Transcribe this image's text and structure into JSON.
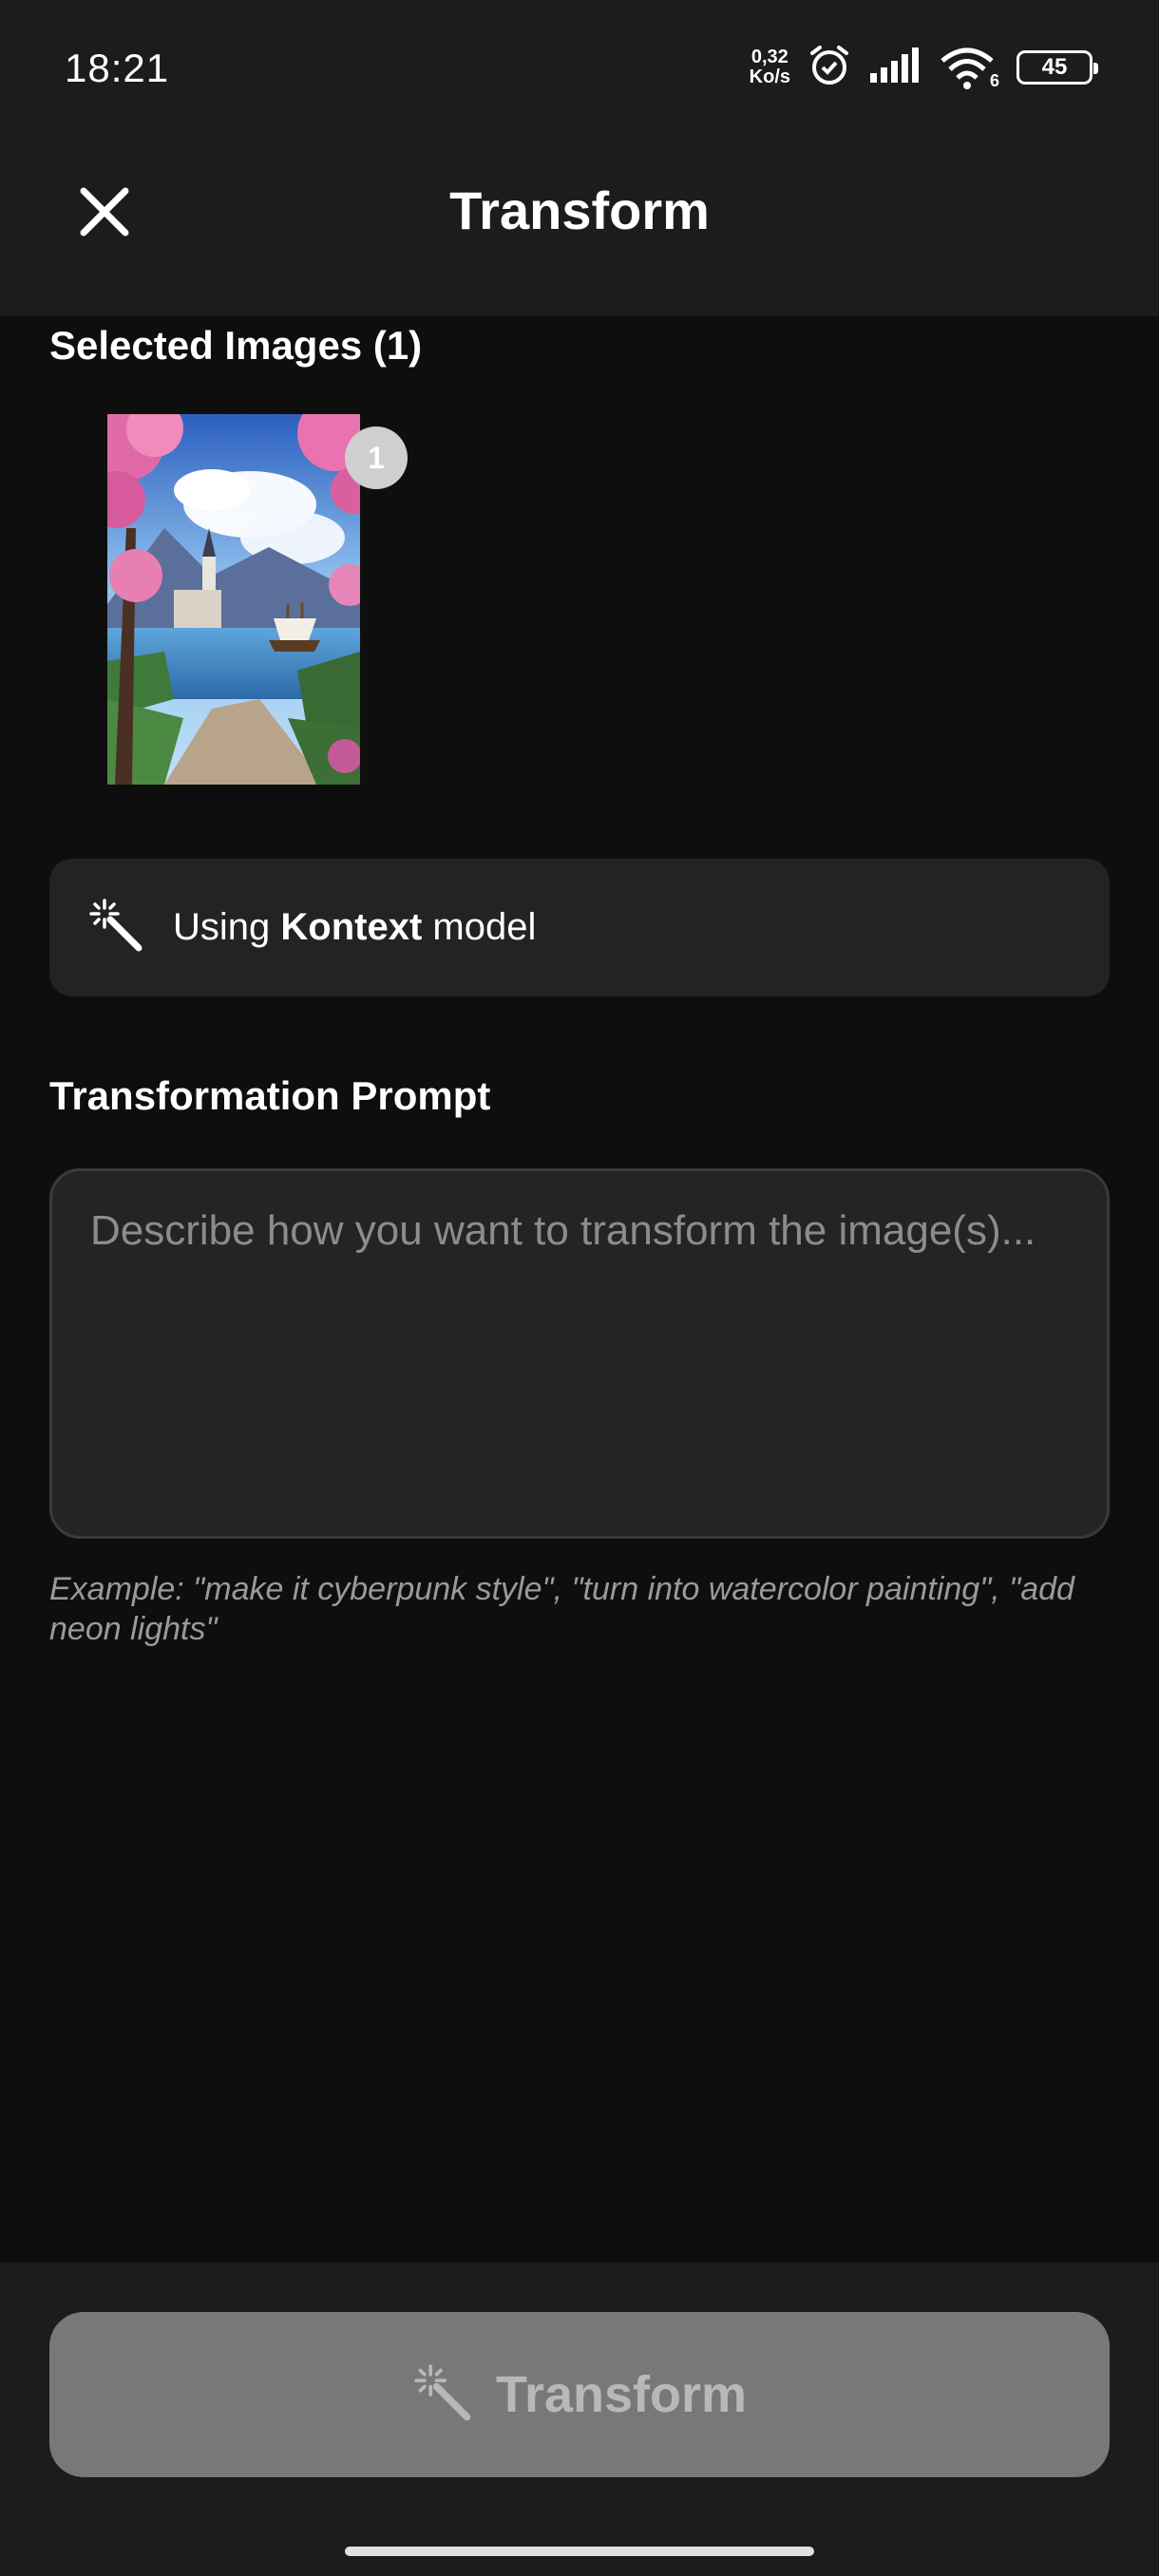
{
  "status_bar": {
    "time": "18:21",
    "net_speed_value": "0,32",
    "net_speed_unit": "Ko/s",
    "wifi_badge": "6",
    "battery_level": "45",
    "icons": [
      "alarm-icon",
      "signal-icon",
      "wifi-icon",
      "battery-icon"
    ]
  },
  "header": {
    "title": "Transform",
    "close_icon": "close-icon"
  },
  "selected_images": {
    "title": "Selected Images (1)",
    "items": [
      {
        "badge": "1"
      }
    ]
  },
  "model": {
    "prefix": "Using ",
    "name": "Kontext",
    "suffix": " model",
    "icon": "magic-wand-icon"
  },
  "prompt": {
    "title": "Transformation Prompt",
    "placeholder": "Describe how you want to transform the image(s)...",
    "value": "",
    "example": "Example: \"make it cyberpunk style\", \"turn into watercolor painting\", \"add neon lights\""
  },
  "action": {
    "label": "Transform",
    "icon": "magic-wand-icon",
    "enabled": false
  },
  "colors": {
    "background": "#0e0e0e",
    "surface": "#1c1c1c",
    "card": "#232323",
    "button_disabled": "#787878"
  }
}
